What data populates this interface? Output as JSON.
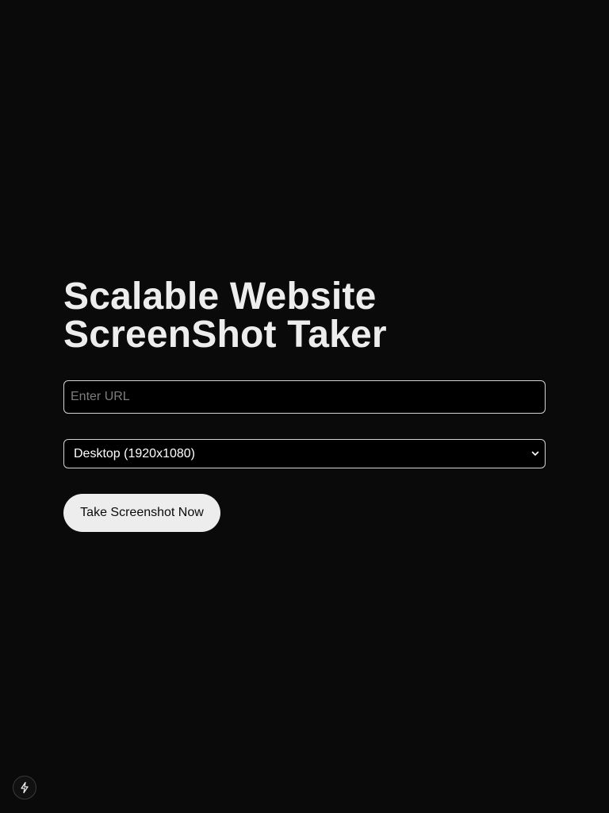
{
  "page": {
    "title_line_1": "Scalable Website",
    "title_line_2": "ScreenShot Taker"
  },
  "form": {
    "url_placeholder": "Enter URL",
    "url_value": "",
    "device_selected": "Desktop (1920x1080)",
    "submit_label": "Take Screenshot Now"
  },
  "icons": {
    "select_chevron": "chevron-down-icon",
    "dev_indicator": "lightning-bolt-icon"
  },
  "colors": {
    "background": "#0a0a0a",
    "text": "#ededed",
    "button_bg": "#ededed",
    "button_text": "#0a0a0a"
  }
}
